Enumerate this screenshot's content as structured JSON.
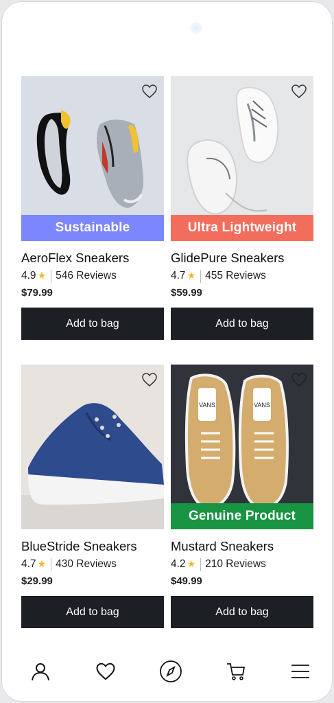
{
  "products": [
    {
      "name": "AeroFlex Sneakers",
      "rating": "4.9",
      "reviews": "546 Reviews",
      "price": "$79.99",
      "badge": "Sustainable",
      "badge_color": "#7b86ff",
      "cta": "Add to bag"
    },
    {
      "name": "GlidePure Sneakers",
      "rating": "4.7",
      "reviews": "455 Reviews",
      "price": "$59.99",
      "badge": "Ultra Lightweight",
      "badge_color": "#f36d5d",
      "cta": "Add to bag"
    },
    {
      "name": "BlueStride Sneakers",
      "rating": "4.7",
      "reviews": "430 Reviews",
      "price": "$29.99",
      "badge": "",
      "cta": "Add to bag"
    },
    {
      "name": "Mustard Sneakers",
      "rating": "4.2",
      "reviews": "210 Reviews",
      "price": "$49.99",
      "badge": "Genuine Product",
      "badge_color": "#189443",
      "cta": "Add to bag"
    }
  ],
  "colors": {
    "button_bg": "#1c1f24",
    "star": "#f6b81e"
  },
  "bottom_nav": [
    {
      "icon": "user-icon"
    },
    {
      "icon": "heart-icon"
    },
    {
      "icon": "compass-icon"
    },
    {
      "icon": "cart-icon"
    },
    {
      "icon": "menu-icon"
    }
  ]
}
